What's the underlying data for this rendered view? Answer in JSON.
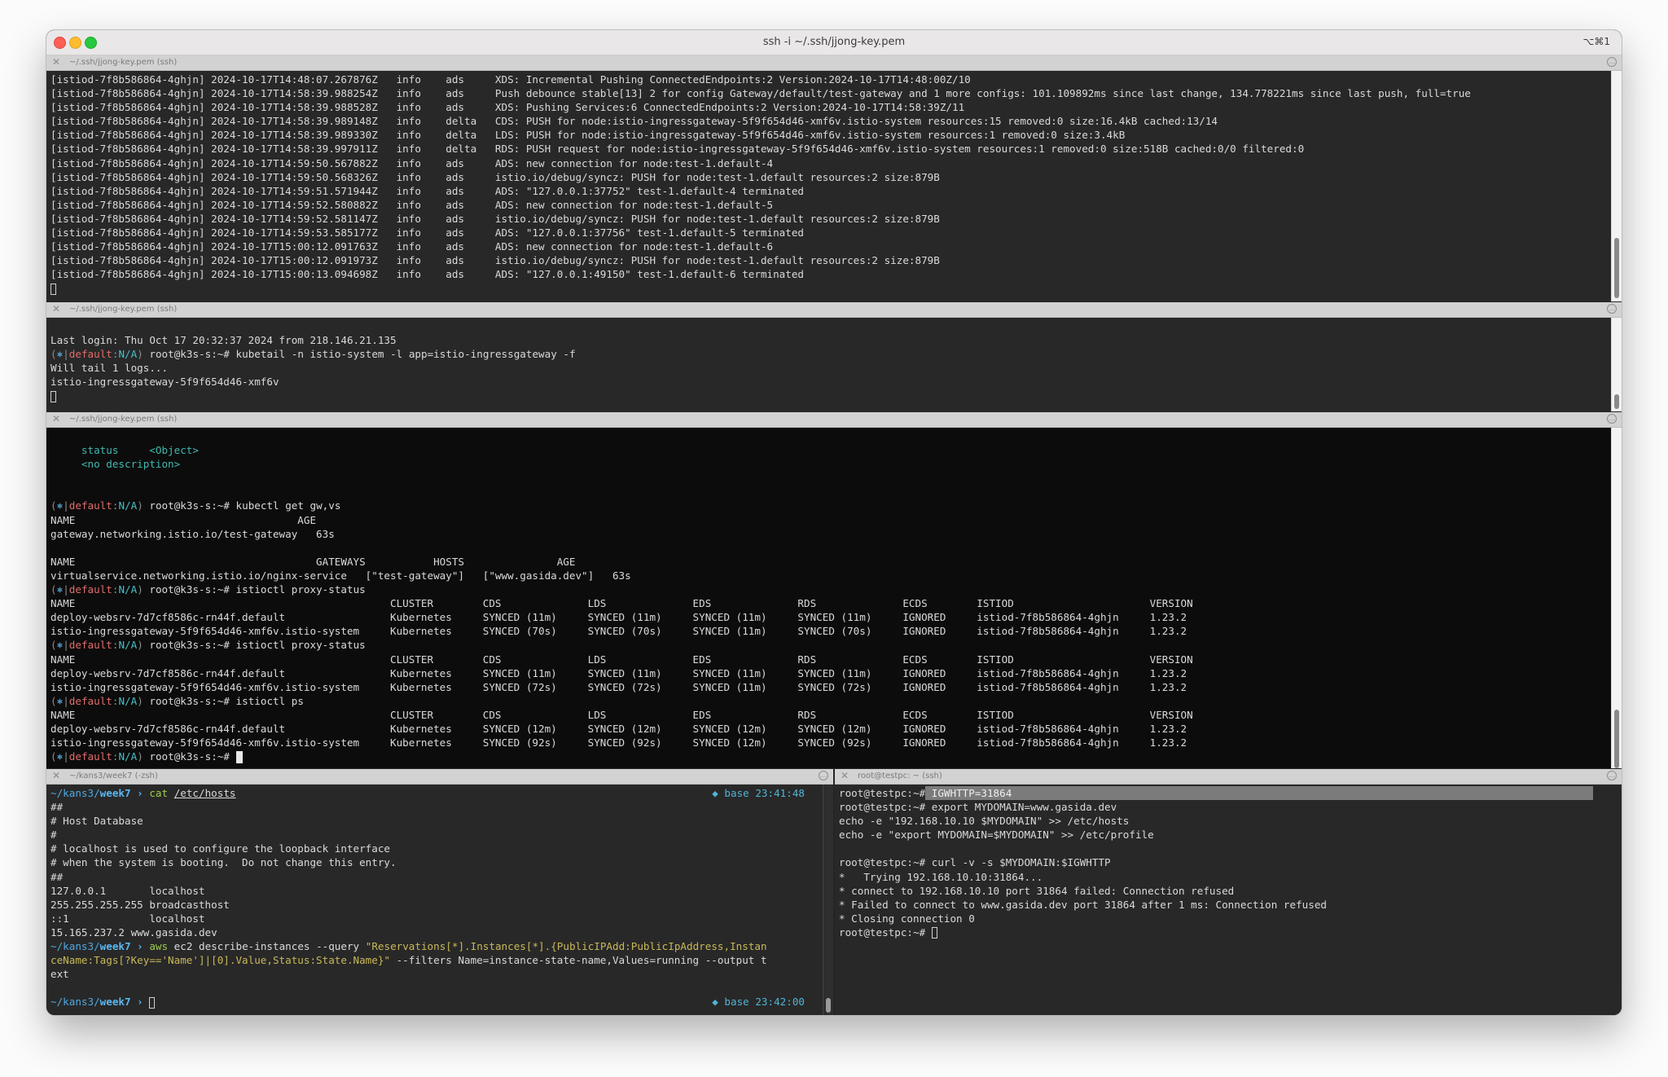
{
  "window": {
    "title": "ssh -i ~/.ssh/jjong-key.pem",
    "shortcut": "⌥⌘1"
  },
  "panes": {
    "p1": {
      "title": "~/.ssh/jjong-key.pem (ssh)",
      "lines": [
        "[istiod-7f8b586864-4ghjn] 2024-10-17T14:48:07.267876Z   info    ads     XDS: Incremental Pushing ConnectedEndpoints:2 Version:2024-10-17T14:48:00Z/10",
        "[istiod-7f8b586864-4ghjn] 2024-10-17T14:58:39.988254Z   info    ads     Push debounce stable[13] 2 for config Gateway/default/test-gateway and 1 more configs: 101.109892ms since last change, 134.778221ms since last push, full=true",
        "[istiod-7f8b586864-4ghjn] 2024-10-17T14:58:39.988528Z   info    ads     XDS: Pushing Services:6 ConnectedEndpoints:2 Version:2024-10-17T14:58:39Z/11",
        "[istiod-7f8b586864-4ghjn] 2024-10-17T14:58:39.989148Z   info    delta   CDS: PUSH for node:istio-ingressgateway-5f9f654d46-xmf6v.istio-system resources:15 removed:0 size:16.4kB cached:13/14",
        "[istiod-7f8b586864-4ghjn] 2024-10-17T14:58:39.989330Z   info    delta   LDS: PUSH for node:istio-ingressgateway-5f9f654d46-xmf6v.istio-system resources:1 removed:0 size:3.4kB",
        "[istiod-7f8b586864-4ghjn] 2024-10-17T14:58:39.997911Z   info    delta   RDS: PUSH request for node:istio-ingressgateway-5f9f654d46-xmf6v.istio-system resources:1 removed:0 size:518B cached:0/0 filtered:0",
        "[istiod-7f8b586864-4ghjn] 2024-10-17T14:59:50.567882Z   info    ads     ADS: new connection for node:test-1.default-4",
        "[istiod-7f8b586864-4ghjn] 2024-10-17T14:59:50.568326Z   info    ads     istio.io/debug/syncz: PUSH for node:test-1.default resources:2 size:879B",
        "[istiod-7f8b586864-4ghjn] 2024-10-17T14:59:51.571944Z   info    ads     ADS: \"127.0.0.1:37752\" test-1.default-4 terminated",
        "[istiod-7f8b586864-4ghjn] 2024-10-17T14:59:52.580882Z   info    ads     ADS: new connection for node:test-1.default-5",
        "[istiod-7f8b586864-4ghjn] 2024-10-17T14:59:52.581147Z   info    ads     istio.io/debug/syncz: PUSH for node:test-1.default resources:2 size:879B",
        "[istiod-7f8b586864-4ghjn] 2024-10-17T14:59:53.585177Z   info    ads     ADS: \"127.0.0.1:37756\" test-1.default-5 terminated",
        "[istiod-7f8b586864-4ghjn] 2024-10-17T15:00:12.091763Z   info    ads     ADS: new connection for node:test-1.default-6",
        "[istiod-7f8b586864-4ghjn] 2024-10-17T15:00:12.091973Z   info    ads     istio.io/debug/syncz: PUSH for node:test-1.default resources:2 size:879B",
        "[istiod-7f8b586864-4ghjn] 2024-10-17T15:00:13.094698Z   info    ads     ADS: \"127.0.0.1:49150\" test-1.default-6 terminated"
      ]
    },
    "p2": {
      "title": "~/.ssh/jjong-key.pem (ssh)",
      "last_login": "Last login: Thu Oct 17 20:32:37 2024 from 218.146.21.135",
      "prompt": {
        "open": "(",
        "sym": "⎈",
        "bar": "|",
        "ctx": "default",
        "sep": ":",
        "ns": "N/A",
        "close": ")",
        "user": " root@k3s-s:~# "
      },
      "command": "kubetail -n istio-system -l app=istio-ingressgateway -f",
      "output": [
        "Will tail 1 logs...",
        "istio-ingressgateway-5f9f654d46-xmf6v"
      ]
    },
    "p3": {
      "title": "~/.ssh/jjong-key.pem (ssh)",
      "status_key": "     status     <Object>",
      "status_desc": "     <no description>",
      "cmd_get": "kubectl get gw,vs",
      "gw_header": "NAME                                    AGE",
      "gw_row": "gateway.networking.istio.io/test-gateway   63s",
      "vs_header": "NAME                                       GATEWAYS           HOSTS               AGE",
      "vs_row": "virtualservice.networking.istio.io/nginx-service   [\"test-gateway\"]   [\"www.gasida.dev\"]   63s",
      "cmd_ps1": "istioctl proxy-status",
      "cmd_ps3": "istioctl ps",
      "ps_header": "NAME                                                   CLUSTER        CDS              LDS              EDS              RDS              ECDS        ISTIOD                      VERSION",
      "ps1_rows": [
        "deploy-websrv-7d7cf8586c-rn44f.default                 Kubernetes     SYNCED (11m)     SYNCED (11m)     SYNCED (11m)     SYNCED (11m)     IGNORED     istiod-7f8b586864-4ghjn     1.23.2",
        "istio-ingressgateway-5f9f654d46-xmf6v.istio-system     Kubernetes     SYNCED (70s)     SYNCED (70s)     SYNCED (11m)     SYNCED (70s)     IGNORED     istiod-7f8b586864-4ghjn     1.23.2"
      ],
      "ps2_rows": [
        "deploy-websrv-7d7cf8586c-rn44f.default                 Kubernetes     SYNCED (11m)     SYNCED (11m)     SYNCED (11m)     SYNCED (11m)     IGNORED     istiod-7f8b586864-4ghjn     1.23.2",
        "istio-ingressgateway-5f9f654d46-xmf6v.istio-system     Kubernetes     SYNCED (72s)     SYNCED (72s)     SYNCED (11m)     SYNCED (72s)     IGNORED     istiod-7f8b586864-4ghjn     1.23.2"
      ],
      "ps3_rows": [
        "deploy-websrv-7d7cf8586c-rn44f.default                 Kubernetes     SYNCED (12m)     SYNCED (12m)     SYNCED (12m)     SYNCED (12m)     IGNORED     istiod-7f8b586864-4ghjn     1.23.2",
        "istio-ingressgateway-5f9f654d46-xmf6v.istio-system     Kubernetes     SYNCED (92s)     SYNCED (92s)     SYNCED (12m)     SYNCED (92s)     IGNORED     istiod-7f8b586864-4ghjn     1.23.2"
      ]
    },
    "p4": {
      "title": "~/kans3/week7 (-zsh)",
      "path": "~/kans3/",
      "dir": "week7",
      "arrow": " › ",
      "cmd1": "cat",
      "cmd1_arg": "/etc/hosts",
      "env1": "◆ base 23:41:48",
      "hosts": [
        "##",
        "# Host Database",
        "#",
        "# localhost is used to configure the loopback interface",
        "# when the system is booting.  Do not change this entry.",
        "##",
        "127.0.0.1       localhost",
        "255.255.255.255 broadcasthost",
        "::1             localhost",
        "15.165.237.2 www.gasida.dev"
      ],
      "cmd2": "aws",
      "cmd2_rest": " ec2 describe-instances --query ",
      "cmd2_q1": "\"Reservations[*].Instances[*].{PublicIPAdd:PublicIpAddress,Instan",
      "cmd2_q2": "ceName:Tags[?Key=='Name']|[0].Value,Status:State.Name}\"",
      "cmd2_q2_rest": " --filters Name=instance-state-name,Values=running --output t",
      "cmd2_tail": "ext",
      "env2": "◆ base 23:42:00"
    },
    "p5": {
      "title": "root@testpc: ~ (ssh)",
      "prompt": "root@testpc:~#",
      "highlighted": " IGWHTTP=31864",
      "lines": [
        "root@testpc:~# export MYDOMAIN=www.gasida.dev",
        "echo -e \"192.168.10.10 $MYDOMAIN\" >> /etc/hosts",
        "echo -e \"export MYDOMAIN=$MYDOMAIN\" >> /etc/profile",
        "",
        "root@testpc:~# curl -v -s $MYDOMAIN:$IGWHTTP",
        "*   Trying 192.168.10.10:31864...",
        "* connect to 192.168.10.10 port 31864 failed: Connection refused",
        "* Failed to connect to www.gasida.dev port 31864 after 1 ms: Connection refused",
        "* Closing connection 0"
      ],
      "last_prompt": "root@testpc:~# "
    }
  },
  "icons": {
    "close": "✕",
    "menu": "…"
  }
}
